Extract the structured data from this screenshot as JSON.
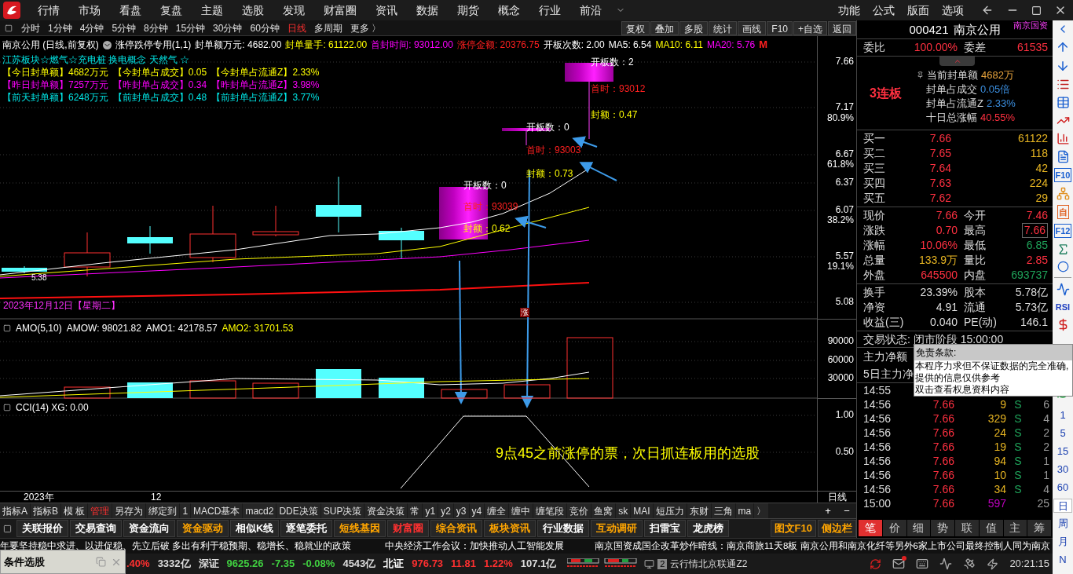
{
  "menu_bar": {
    "items": [
      "行情",
      "市场",
      "看盘",
      "复盘",
      "主题",
      "选股",
      "发现",
      "财富圈",
      "资讯",
      "数据",
      "期货",
      "概念",
      "行业",
      "前沿"
    ],
    "right_items": [
      "功能",
      "公式",
      "版面",
      "选项"
    ]
  },
  "period_tabs": [
    {
      "label": "分时",
      "selected": false
    },
    {
      "label": "1分钟",
      "selected": false
    },
    {
      "label": "4分钟",
      "selected": false
    },
    {
      "label": "5分钟",
      "selected": false
    },
    {
      "label": "8分钟",
      "selected": false
    },
    {
      "label": "15分钟",
      "selected": false
    },
    {
      "label": "30分钟",
      "selected": false
    },
    {
      "label": "60分钟",
      "selected": false
    },
    {
      "label": "日线",
      "selected": true
    },
    {
      "label": "多周期",
      "selected": false
    },
    {
      "label": "更多 〉",
      "selected": false
    }
  ],
  "chart_tools": [
    "复权",
    "叠加",
    "多股",
    "统计",
    "画线",
    "F10",
    "+自选",
    "返回"
  ],
  "chart": {
    "title": "南京公用 (日线,前复权)",
    "indicator": "涨停跌停专用(1,1)",
    "stats": [
      {
        "text": "封单额万元: 4682.00",
        "color": "#ffffff"
      },
      {
        "text": "封单量手: 61122.00",
        "color": "#ffff00"
      },
      {
        "text": "首封时间: 93012.00",
        "color": "#ff00ff"
      },
      {
        "text": "涨停金额: 20376.75",
        "color": "#ff2020"
      },
      {
        "text": "开板次数: 2.00",
        "color": "#ffffff"
      },
      {
        "text": "MA5: 6.54",
        "color": "#ffffff"
      },
      {
        "text": "MA10: 6.11",
        "color": "#ffff00"
      },
      {
        "text": "MA20: 5.76",
        "color": "#ff00ff"
      },
      {
        "text": "M",
        "color": "#ff2020"
      }
    ],
    "concepts": "江苏板块☆燃气☆充电桩 换电概念 天然气 ☆",
    "seal_rows": [
      {
        "color": "#ffff00",
        "items": [
          "【今日封单额】4682万元",
          "【今封单占成交】0.05",
          "【今封单占流通Z】2.33%"
        ]
      },
      {
        "color": "#ff00ff",
        "items": [
          "【昨日封单额】7257万元",
          "【昨封单占成交】0.34",
          "【昨封单占流通Z】3.98%"
        ]
      },
      {
        "color": "#00e5e5",
        "items": [
          "【前天封单额】6248万元",
          "【前封单占成交】0.48",
          "【前封单占流通Z】3.77%"
        ]
      }
    ],
    "annotations": [
      {
        "kind": "open_count",
        "text": "开板数：2"
      },
      {
        "kind": "first_time",
        "text": "首时：93012"
      },
      {
        "kind": "seal",
        "text": "封额：0.47"
      },
      {
        "kind": "open_count",
        "text": "开板数：0"
      },
      {
        "kind": "first_time",
        "text": "首时：93003"
      },
      {
        "kind": "seal",
        "text": "封额：0.73"
      },
      {
        "kind": "open_count",
        "text": "开板数：0"
      },
      {
        "kind": "first_time",
        "text": "首时：93039"
      },
      {
        "kind": "seal",
        "text": "封额：0.62"
      }
    ],
    "low_label": "5.38",
    "marker": "涨",
    "date_label": "2023年12月12日【星期二】",
    "price_axis": [
      "7.66",
      "7.17",
      "80.9%",
      "6.67",
      "61.8%",
      "6.37",
      "6.07",
      "38.2%",
      "5.57",
      "19.1%",
      "5.08"
    ]
  },
  "amo": {
    "header": [
      {
        "text": "AMO(5,10)",
        "color": "#ffffff"
      },
      {
        "text": "AMOW: 98021.82",
        "color": "#ffffff"
      },
      {
        "text": "AMO1: 42178.57",
        "color": "#ffffff"
      },
      {
        "text": "AMO2: 31701.53",
        "color": "#ffff00"
      }
    ],
    "axis": [
      "90000",
      "60000",
      "30000"
    ]
  },
  "cci": {
    "header": "CCI(14) XG: 0.00",
    "axis": [
      "1.00",
      "0.50"
    ],
    "note": "9点45之前涨停的票，次日抓连板用的选股"
  },
  "time_axis": [
    "2023年",
    "12"
  ],
  "period_label": "日线",
  "indicator_tabs": [
    {
      "label": "指标A",
      "selected": false
    },
    {
      "label": "指标B",
      "selected": false
    },
    {
      "label": "模 板",
      "selected": false
    },
    {
      "label": "管理",
      "selected": true
    },
    {
      "label": "另存为",
      "selected": false
    },
    {
      "label": "绑定到",
      "selected": false
    },
    {
      "label": "1",
      "selected": false
    },
    {
      "label": "MACD基本",
      "selected": false
    },
    {
      "label": "macd2",
      "selected": false
    },
    {
      "label": "DDE决策",
      "selected": false
    },
    {
      "label": "SUP决策",
      "selected": false
    },
    {
      "label": "资金决策",
      "selected": false
    },
    {
      "label": "常",
      "selected": false
    },
    {
      "label": "y1",
      "selected": false
    },
    {
      "label": "y2",
      "selected": false
    },
    {
      "label": "y3",
      "selected": false
    },
    {
      "label": "y4",
      "selected": false
    },
    {
      "label": "缠全",
      "selected": false
    },
    {
      "label": "缠中",
      "selected": false
    },
    {
      "label": "缠笔段",
      "selected": false
    },
    {
      "label": "竞价",
      "selected": false
    },
    {
      "label": "鱼窝",
      "selected": false
    },
    {
      "label": "sk",
      "selected": false
    },
    {
      "label": "MAI",
      "selected": false
    },
    {
      "label": "短压力",
      "selected": false
    },
    {
      "label": "东财",
      "selected": false
    },
    {
      "label": "三角",
      "selected": false
    },
    {
      "label": "ma",
      "selected": false
    },
    {
      "label": "〉",
      "selected": false
    }
  ],
  "zoom_buttons": [
    "+",
    "−"
  ],
  "function_buttons": [
    {
      "label": "关联报价",
      "color": "#ffffff"
    },
    {
      "label": "交易查询",
      "color": "#ffffff"
    },
    {
      "label": "资金流向",
      "color": "#ffffff"
    },
    {
      "label": "资金驱动",
      "color": "#ffa500"
    },
    {
      "label": "相似K线",
      "color": "#ffffff"
    },
    {
      "label": "逐笔委托",
      "color": "#ffffff"
    },
    {
      "label": "短线基因",
      "color": "#ffa500"
    },
    {
      "label": "财富圈",
      "color": "#ff3030"
    },
    {
      "label": "综合资讯",
      "color": "#ffa500"
    },
    {
      "label": "板块资讯",
      "color": "#ffa500"
    },
    {
      "label": "行业数据",
      "color": "#ffffff"
    },
    {
      "label": "互动调研",
      "color": "#ffa500"
    },
    {
      "label": "扫雷宝",
      "color": "#ffffff"
    },
    {
      "label": "龙虎榜",
      "color": "#ffffff"
    }
  ],
  "side_buttons": [
    {
      "label": "图文F10",
      "color": "#ffa500"
    },
    {
      "label": "侧边栏",
      "color": "#ffa500"
    }
  ],
  "news": [
    "年要坚持稳中求进、以进促稳、先立后破 多出有利于稳预期、稳增长、稳就业的政策",
    "中央经济工作会议：加快推动人工智能发展",
    "南京国资成国企改革炒作暗线：南京商旅11天8板 南京公用和南京化纤等另外6家上市公司最终控制人同为南京"
  ],
  "status_bar": {
    "panel_title": "条件选股",
    "items": [
      {
        "text": ".40%",
        "color": "#ff3030"
      },
      {
        "text": "3332亿",
        "color": "#dddddd"
      },
      {
        "text": "深证",
        "color": "#dddddd"
      },
      {
        "text": "9625.26",
        "color": "#40d040"
      },
      {
        "text": "-7.35",
        "color": "#40d040"
      },
      {
        "text": "-0.08%",
        "color": "#40d040"
      },
      {
        "text": "4543亿",
        "color": "#dddddd"
      },
      {
        "text": "北证",
        "color": "#ffffff"
      },
      {
        "text": "976.73",
        "color": "#ff3030"
      },
      {
        "text": "11.81",
        "color": "#ff3030"
      },
      {
        "text": "1.22%",
        "color": "#ff3030"
      },
      {
        "text": "107.1亿",
        "color": "#dddddd"
      }
    ],
    "server_count": "2",
    "server": "云行情北京联通Z2",
    "time": "20:21:15"
  },
  "quote": {
    "code": "000421",
    "name": "南京公用",
    "tag": "南京国资",
    "ratio": [
      {
        "label": "委比",
        "value": "100.00%"
      },
      {
        "label": "委差",
        "value": "61535"
      }
    ],
    "streak": "3连板",
    "seal_info": [
      {
        "label": "当前封单额",
        "value": "4682万",
        "color": "#e6a23c"
      },
      {
        "label": "封单占成交",
        "value": "0.05倍",
        "color": "#3b8fe0"
      },
      {
        "label": "封单占流通Z",
        "value": "2.33%",
        "color": "#3b8fe0"
      },
      {
        "label": "十日总涨幅",
        "value": "40.55%",
        "color": "#ff3040"
      }
    ],
    "bids": [
      {
        "label": "买一",
        "price": "7.66",
        "volume": "61122"
      },
      {
        "label": "买二",
        "price": "7.65",
        "volume": "118"
      },
      {
        "label": "买三",
        "price": "7.64",
        "volume": "42"
      },
      {
        "label": "买四",
        "price": "7.63",
        "volume": "224"
      },
      {
        "label": "买五",
        "price": "7.62",
        "volume": "29"
      }
    ],
    "stats": [
      {
        "label": "现价",
        "value": "7.66",
        "color": "#ff3040",
        "highlighted": false
      },
      {
        "label": "今开",
        "value": "7.46",
        "color": "#ff3040",
        "highlighted": false
      },
      {
        "label": "涨跌",
        "value": "0.70",
        "color": "#ff3040",
        "highlighted": false
      },
      {
        "label": "最高",
        "value": "7.66",
        "color": "#ff3040",
        "highlighted": true
      },
      {
        "label": "涨幅",
        "value": "10.06%",
        "color": "#ff3040",
        "highlighted": false
      },
      {
        "label": "最低",
        "value": "6.85",
        "color": "#1fa35a",
        "highlighted": false
      },
      {
        "label": "总量",
        "value": "133.9万",
        "color": "#e6b422",
        "highlighted": false
      },
      {
        "label": "量比",
        "value": "2.85",
        "color": "#ff3040",
        "highlighted": false
      },
      {
        "label": "外盘",
        "value": "645500",
        "color": "#ff3040",
        "highlighted": false
      },
      {
        "label": "内盘",
        "value": "693737",
        "color": "#1fa35a",
        "highlighted": false
      }
    ],
    "fundamentals": [
      {
        "label": "换手",
        "value": "23.39%"
      },
      {
        "label": "股本",
        "value": "5.78亿"
      },
      {
        "label": "净资",
        "value": "4.91"
      },
      {
        "label": "流通",
        "value": "5.73亿"
      },
      {
        "label": "收益(三)",
        "value": "0.040"
      },
      {
        "label": "PE(动)",
        "value": "146.1"
      }
    ],
    "trade_status": "交易状态: 闭市阶段 15:00:00",
    "capital_flow": [
      "主力净额",
      "5日主力净"
    ],
    "ticks": [
      {
        "time": "14:55"
      },
      {
        "time": "14:56",
        "price": "7.66",
        "volume": "9",
        "side": "S",
        "count": "6",
        "color": "#e6b422"
      },
      {
        "time": "14:56",
        "price": "7.66",
        "volume": "329",
        "side": "S",
        "count": "4",
        "color": "#e6b422"
      },
      {
        "time": "14:56",
        "price": "7.66",
        "volume": "24",
        "side": "S",
        "count": "2",
        "color": "#e6b422"
      },
      {
        "time": "14:56",
        "price": "7.66",
        "volume": "19",
        "side": "S",
        "count": "2",
        "color": "#e6b422"
      },
      {
        "time": "14:56",
        "price": "7.66",
        "volume": "94",
        "side": "S",
        "count": "1",
        "color": "#e6b422"
      },
      {
        "time": "14:56",
        "price": "7.66",
        "volume": "10",
        "side": "S",
        "count": "1",
        "color": "#e6b422"
      },
      {
        "time": "14:56",
        "price": "7.66",
        "volume": "34",
        "side": "S",
        "count": "4",
        "color": "#e6b422"
      },
      {
        "time": "15:00",
        "price": "7.66",
        "volume": "597",
        "count": "25",
        "color": "#c000c0"
      }
    ],
    "tabs": [
      {
        "label": "笔",
        "selected": true
      },
      {
        "label": "价",
        "selected": false
      },
      {
        "label": "细",
        "selected": false
      },
      {
        "label": "势",
        "selected": false
      },
      {
        "label": "联",
        "selected": false
      },
      {
        "label": "值",
        "selected": false
      },
      {
        "label": "主",
        "selected": false
      },
      {
        "label": "筹",
        "selected": false
      }
    ]
  },
  "tooltip": {
    "title": "免责条款:",
    "lines": [
      "本程序力求但不保证数据的完全准确,",
      "提供的信息仅供参考",
      "双击查看权息资料内容"
    ]
  },
  "side_toolbar": {
    "labels": [
      "F10",
      "自",
      "F12",
      "RSI"
    ],
    "periods": [
      {
        "label": "1",
        "selected": false
      },
      {
        "label": "5",
        "selected": false
      },
      {
        "label": "15",
        "selected": false
      },
      {
        "label": "30",
        "selected": false
      },
      {
        "label": "60",
        "selected": false
      },
      {
        "label": "日",
        "selected": true
      },
      {
        "label": "周",
        "selected": false
      },
      {
        "label": "月",
        "selected": false
      },
      {
        "label": "N",
        "selected": false
      }
    ]
  }
}
